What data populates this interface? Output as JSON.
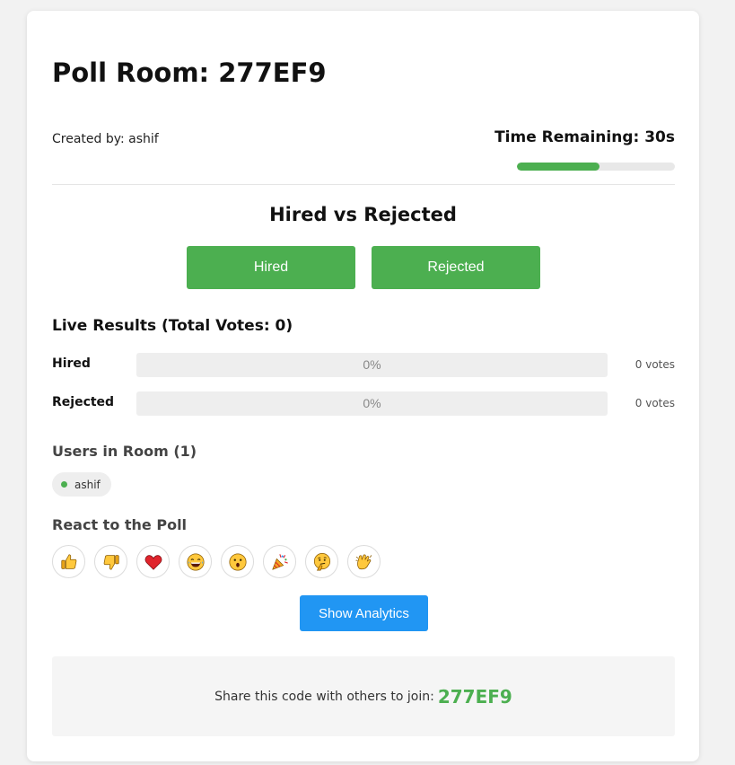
{
  "room": {
    "title": "Poll Room: 277EF9",
    "created_by": "Created by: ashif",
    "time_remaining": "Time Remaining: 30s",
    "time_progress_percent": 52
  },
  "poll": {
    "question": "Hired vs Rejected",
    "options": [
      "Hired",
      "Rejected"
    ]
  },
  "results": {
    "heading": "Live Results (Total Votes: 0)",
    "rows": [
      {
        "label": "Hired",
        "percent_text": "0%",
        "percent": 0,
        "votes": "0 votes"
      },
      {
        "label": "Rejected",
        "percent_text": "0%",
        "percent": 0,
        "votes": "0 votes"
      }
    ]
  },
  "users": {
    "heading": "Users in Room (1)",
    "list": [
      "ashif"
    ],
    "online_color": "#4caf50"
  },
  "reactions": {
    "heading": "React to the Poll",
    "icons": [
      "thumbs-up-icon",
      "thumbs-down-icon",
      "heart-icon",
      "laughing-face-icon",
      "surprised-face-icon",
      "party-popper-icon",
      "thinking-face-icon",
      "clapping-hands-icon"
    ]
  },
  "actions": {
    "show_analytics": "Show Analytics"
  },
  "share": {
    "text": "Share this code with others to join:",
    "code": "277EF9"
  },
  "colors": {
    "accent_green": "#4caf50",
    "accent_blue": "#2196f3"
  }
}
